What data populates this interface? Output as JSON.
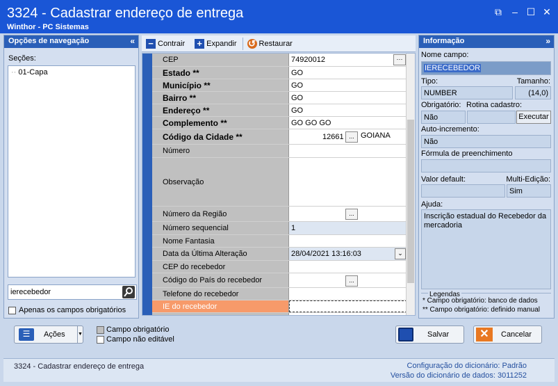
{
  "window": {
    "title": "3324 - Cadastrar endereço de entrega",
    "subtitle": "Winthor - PC Sistemas"
  },
  "nav_panel": {
    "header": "Opções de navegação",
    "sections_label": "Seções:",
    "tree_items": [
      "01-Capa"
    ],
    "search_value": "ierecebedor",
    "only_required_label": "Apenas os campos obrigatórios"
  },
  "toolbar": {
    "collapse": "Contrair",
    "expand": "Expandir",
    "restore": "Restaurar"
  },
  "grid": {
    "rows": [
      {
        "label": "CEP",
        "value": "74920012"
      },
      {
        "label": "Estado **",
        "value": "GO"
      },
      {
        "label": "Município **",
        "value": "GO"
      },
      {
        "label": "Bairro **",
        "value": "GO"
      },
      {
        "label": "Endereço **",
        "value": "GO"
      },
      {
        "label": "Complemento **",
        "value": "GO GO GO"
      },
      {
        "label": "Código da Cidade **",
        "value": "12661",
        "extra": "GOIANA"
      },
      {
        "label": "Número",
        "value": ""
      },
      {
        "label": "Observação",
        "value": ""
      },
      {
        "label": "Número da Região",
        "value": ""
      },
      {
        "label": "Número sequencial",
        "value": "1"
      },
      {
        "label": "Nome Fantasia",
        "value": ""
      },
      {
        "label": "Data da Última Alteração",
        "value": "28/04/2021 13:16:03"
      },
      {
        "label": "CEP do recebedor",
        "value": ""
      },
      {
        "label": "Código do País do recebedor",
        "value": ""
      },
      {
        "label": "Telefone do recebedor",
        "value": ""
      },
      {
        "label": "IE do recebedor",
        "value": ""
      }
    ]
  },
  "info_panel": {
    "header": "Informação",
    "nome_campo_label": "Nome campo:",
    "nome_campo_value": "IERECEBEDOR",
    "tipo_label": "Tipo:",
    "tipo_value": "NUMBER",
    "tamanho_label": "Tamanho:",
    "tamanho_value": "(14,0)",
    "obrigatorio_label": "Obrigatório:",
    "obrigatorio_value": "Não",
    "rotina_label": "Rotina cadastro:",
    "executar_label": "Executar",
    "auto_inc_label": "Auto-incremento:",
    "auto_inc_value": "Não",
    "formula_label": "Fórmula de preenchimento",
    "valor_default_label": "Valor default:",
    "multi_edicao_label": "Multi-Edição:",
    "multi_edicao_value": "Sim",
    "ajuda_label": "Ajuda:",
    "ajuda_value": "Inscrição estadual do Recebedor da mercadoria",
    "legendas_label": "Legendas",
    "legend_1": "* Campo obrigatório: banco de dados",
    "legend_2": "** Campo obrigatório: definido manual"
  },
  "bottom": {
    "acoes_label": "Ações",
    "legend_required": "Campo obrigatório",
    "legend_noneditable": "Campo não editável",
    "save_label": "Salvar",
    "cancel_label": "Cancelar"
  },
  "status": {
    "left": "3324 - Cadastrar endereço de entrega",
    "dict_config_label": "Configuração do dicionário:",
    "dict_config_value": "Padrão",
    "dict_version_label": "Versão do dicionário de dados:",
    "dict_version_value": "3011252"
  },
  "colors": {
    "titlebar": "#1a56d6",
    "highlight_row": "#f79a6a",
    "accent": "#2a5fb8"
  }
}
